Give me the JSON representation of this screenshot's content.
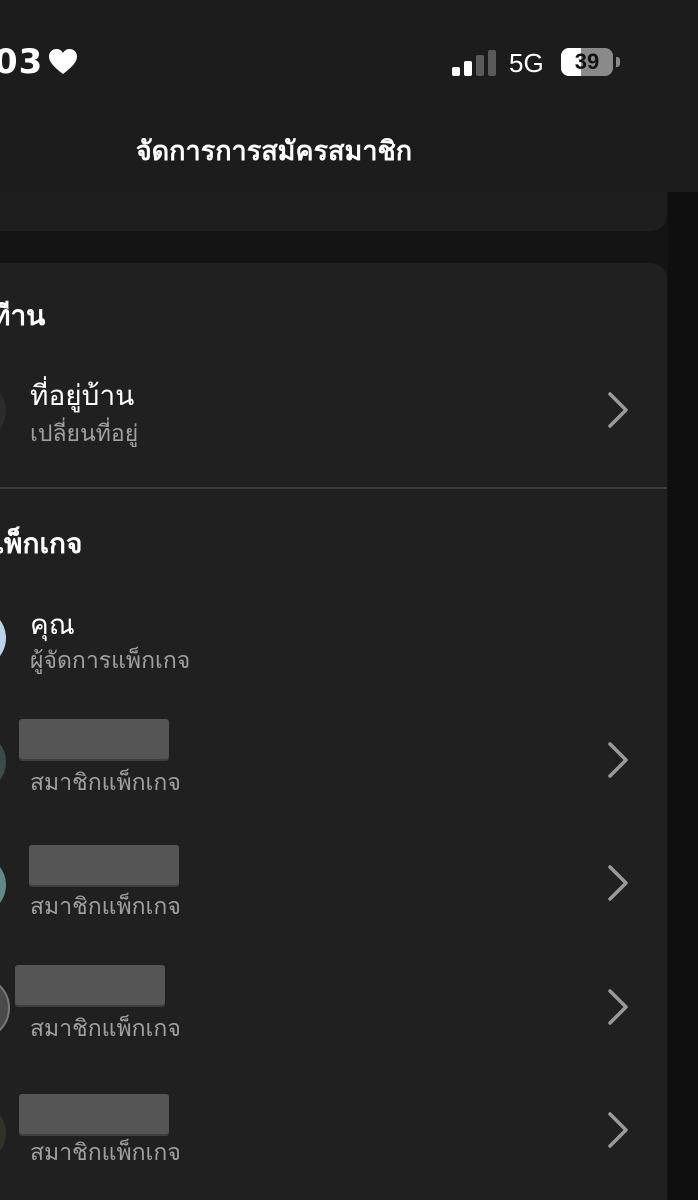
{
  "status_bar": {
    "time": "03",
    "network": "5G",
    "battery_level": "39",
    "battery_fraction": 0.39
  },
  "nav": {
    "title": "จัดการการสมัครสมาชิก"
  },
  "home_section": {
    "title": "ทีาน",
    "address_row": {
      "title": "ที่อยู่บ้าน",
      "subtitle": "เปลี่ยนที่อยู่"
    }
  },
  "package_section": {
    "title": "แพ็กเกจ",
    "members": [
      {
        "name": "คุณ",
        "role": "ผู้จัดการแพ็กเกจ",
        "avatar_color": "#bcd3ea",
        "chevron": false,
        "redacted": false
      },
      {
        "name": "",
        "role": "สมาชิกแพ็กเกจ",
        "avatar_color": "#3b4a4a",
        "chevron": true,
        "redacted": true
      },
      {
        "name": "",
        "role": "สมาชิกแพ็กเกจ",
        "avatar_color": "#5f8a86",
        "chevron": true,
        "redacted": true
      },
      {
        "name": "",
        "role": "สมาชิกแพ็กเกจ",
        "avatar_color": "#4a4a4a",
        "chevron": true,
        "redacted": true
      },
      {
        "name": "",
        "role": "สมาชิกแพ็กเกจ",
        "avatar_color": "#2f3328",
        "chevron": true,
        "redacted": true
      }
    ]
  },
  "colors": {
    "background": "#141414",
    "card": "#202020",
    "text_primary": "#ffffff",
    "text_secondary": "#a0a0a0",
    "chevron": "#9a9a9a"
  },
  "icons": [
    "heart-icon",
    "signal-icon",
    "battery-icon",
    "chevron-right-icon"
  ]
}
